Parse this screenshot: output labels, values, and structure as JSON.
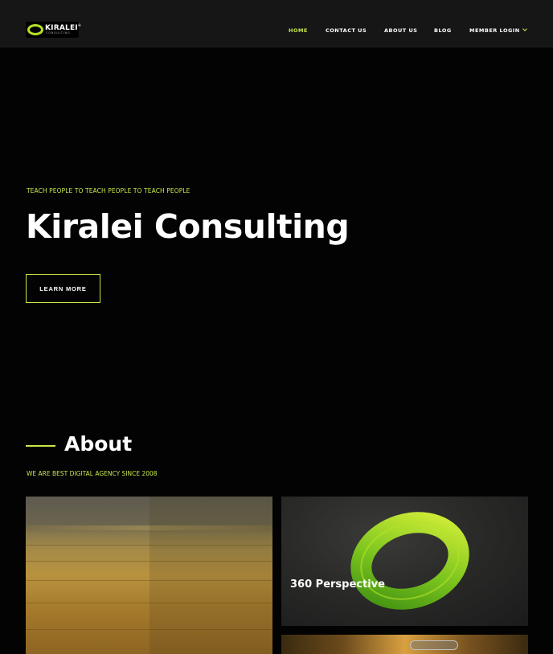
{
  "brand": {
    "name": "KIRALEI",
    "trademark": "®",
    "tagline": "CONSULTING",
    "accent_color": "#c6e84b"
  },
  "nav": {
    "items": [
      {
        "label": "HOME",
        "active": true
      },
      {
        "label": "CONTACT US",
        "active": false
      },
      {
        "label": "ABOUT US",
        "active": false
      },
      {
        "label": "BLOG",
        "active": false
      },
      {
        "label": "MEMBER LOGIN",
        "active": false,
        "icon": "chevron-down-icon"
      }
    ]
  },
  "hero": {
    "tagline": "TEACH PEOPLE TO TEACH PEOPLE TO TEACH PEOPLE",
    "title": "Kiralei Consulting",
    "button_label": "LEARN MORE"
  },
  "about": {
    "title": "About",
    "subtitle": "WE ARE BEST DIGITAL AGENCY SINCE 2008"
  },
  "cards": [
    {
      "image": "wheat-field-photo",
      "label": ""
    },
    {
      "image": "green-ring-photo",
      "label": "360 Perspective"
    },
    {
      "image": "industrial-photo",
      "label": ""
    }
  ]
}
